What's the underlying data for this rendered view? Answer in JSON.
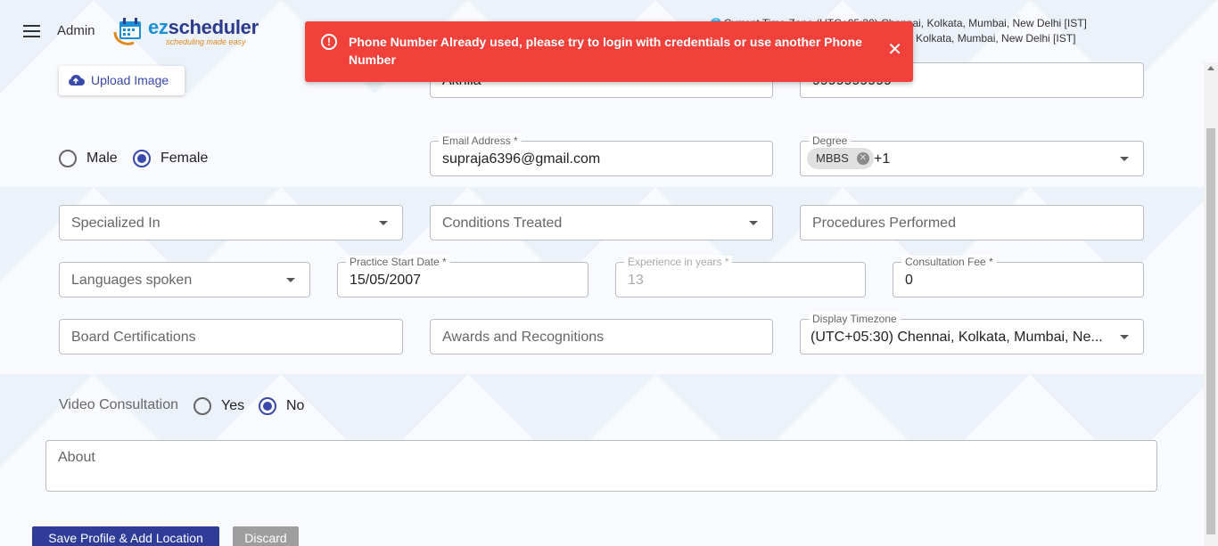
{
  "header": {
    "menu_icon": "hamburger-menu-icon",
    "role_label": "Admin",
    "logo": {
      "text_ez": "ez",
      "text_rest": "scheduler",
      "tagline": "scheduling made easy"
    },
    "timezone_line1": "Current Time Zone (UTC+05:30) Chennai, Kolkata, Mumbai, New Delhi [IST]",
    "timezone_line2": "Kolkata, Mumbai, New Delhi [IST]"
  },
  "toast": {
    "type": "error",
    "message": "Phone Number Already used, please try to login with credentials or use another Phone Number",
    "color": "#f2403a"
  },
  "upload": {
    "label": "Upload Image",
    "icon": "cloud-upload-icon"
  },
  "row0": {
    "first_name_value": "Akhila",
    "phone_value": "9999999999"
  },
  "gender": {
    "options": [
      "Male",
      "Female"
    ],
    "selected": "Female"
  },
  "email": {
    "label": "Email Address *",
    "value": "supraja6396@gmail.com"
  },
  "degree": {
    "label": "Degree",
    "chip": "MBBS",
    "more": "+1"
  },
  "specialized": {
    "placeholder": "Specialized In"
  },
  "conditions": {
    "placeholder": "Conditions Treated"
  },
  "procedures": {
    "placeholder": "Procedures Performed"
  },
  "languages": {
    "placeholder": "Languages spoken"
  },
  "practice_start": {
    "label": "Practice Start Date *",
    "value": "15/05/2007"
  },
  "experience": {
    "label": "Experience in years *",
    "value": "13"
  },
  "fee": {
    "label": "Consultation Fee  *",
    "value": "0"
  },
  "board": {
    "placeholder": "Board Certifications"
  },
  "awards": {
    "placeholder": "Awards and Recognitions"
  },
  "display_tz": {
    "label": "Display Timezone",
    "value": "(UTC+05:30) Chennai, Kolkata, Mumbai, Ne..."
  },
  "video": {
    "label": "Video Consultation",
    "options": [
      "Yes",
      "No"
    ],
    "selected": "No"
  },
  "about": {
    "placeholder": "About"
  },
  "actions": {
    "save_label": "Save Profile & Add Location",
    "discard_label": "Discard"
  },
  "colors": {
    "primary": "#3949ab",
    "save_button": "#2f3d99",
    "discard_button": "#9e9e9e"
  }
}
